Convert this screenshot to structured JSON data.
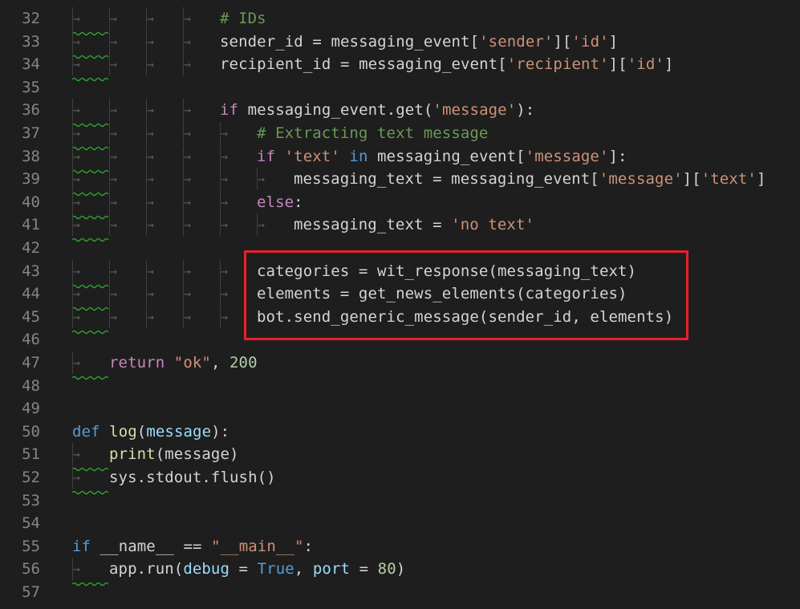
{
  "editor": {
    "lines": [
      {
        "n": "32",
        "indent": 4,
        "tokens": [
          {
            "t": "# IDs",
            "c": "cm"
          }
        ]
      },
      {
        "n": "33",
        "indent": 4,
        "tokens": [
          {
            "t": "sender_id",
            "c": "plain"
          },
          {
            "t": " = ",
            "c": "plain"
          },
          {
            "t": "messaging_event",
            "c": "plain"
          },
          {
            "t": "[",
            "c": "plain"
          },
          {
            "t": "'sender'",
            "c": "str"
          },
          {
            "t": "][",
            "c": "plain"
          },
          {
            "t": "'id'",
            "c": "str"
          },
          {
            "t": "]",
            "c": "plain"
          }
        ]
      },
      {
        "n": "34",
        "indent": 4,
        "tokens": [
          {
            "t": "recipient_id",
            "c": "plain"
          },
          {
            "t": " = ",
            "c": "plain"
          },
          {
            "t": "messaging_event",
            "c": "plain"
          },
          {
            "t": "[",
            "c": "plain"
          },
          {
            "t": "'recipient'",
            "c": "str"
          },
          {
            "t": "][",
            "c": "plain"
          },
          {
            "t": "'id'",
            "c": "str"
          },
          {
            "t": "]",
            "c": "plain"
          }
        ]
      },
      {
        "n": "35",
        "indent": 0,
        "tokens": []
      },
      {
        "n": "36",
        "indent": 4,
        "tokens": [
          {
            "t": "if",
            "c": "kw"
          },
          {
            "t": " messaging_event.get(",
            "c": "plain"
          },
          {
            "t": "'message'",
            "c": "str"
          },
          {
            "t": "):",
            "c": "plain"
          }
        ]
      },
      {
        "n": "37",
        "indent": 5,
        "tokens": [
          {
            "t": "# Extracting text message",
            "c": "cm"
          }
        ]
      },
      {
        "n": "38",
        "indent": 5,
        "tokens": [
          {
            "t": "if",
            "c": "kw"
          },
          {
            "t": " ",
            "c": "plain"
          },
          {
            "t": "'text'",
            "c": "str"
          },
          {
            "t": " ",
            "c": "plain"
          },
          {
            "t": "in",
            "c": "kw2"
          },
          {
            "t": " messaging_event[",
            "c": "plain"
          },
          {
            "t": "'message'",
            "c": "str"
          },
          {
            "t": "]:",
            "c": "plain"
          }
        ]
      },
      {
        "n": "39",
        "indent": 6,
        "tokens": [
          {
            "t": "messaging_text = messaging_event[",
            "c": "plain"
          },
          {
            "t": "'message'",
            "c": "str"
          },
          {
            "t": "][",
            "c": "plain"
          },
          {
            "t": "'text'",
            "c": "str"
          },
          {
            "t": "]",
            "c": "plain"
          }
        ]
      },
      {
        "n": "40",
        "indent": 5,
        "tokens": [
          {
            "t": "else",
            "c": "kw"
          },
          {
            "t": ":",
            "c": "plain"
          }
        ]
      },
      {
        "n": "41",
        "indent": 6,
        "tokens": [
          {
            "t": "messaging_text = ",
            "c": "plain"
          },
          {
            "t": "'no text'",
            "c": "str"
          }
        ]
      },
      {
        "n": "42",
        "indent": 0,
        "tokens": []
      },
      {
        "n": "43",
        "indent": 5,
        "tokens": [
          {
            "t": "categories = wit_response(messaging_text)",
            "c": "plain"
          }
        ]
      },
      {
        "n": "44",
        "indent": 5,
        "tokens": [
          {
            "t": "elements = get_news_elements(categories)",
            "c": "plain"
          }
        ]
      },
      {
        "n": "45",
        "indent": 5,
        "tokens": [
          {
            "t": "bot.send_generic_message(sender_id, elements)",
            "c": "plain"
          }
        ]
      },
      {
        "n": "46",
        "indent": 0,
        "tokens": []
      },
      {
        "n": "47",
        "indent": 1,
        "tokens": [
          {
            "t": "return",
            "c": "kw"
          },
          {
            "t": " ",
            "c": "plain"
          },
          {
            "t": "\"ok\"",
            "c": "str"
          },
          {
            "t": ", ",
            "c": "plain"
          },
          {
            "t": "200",
            "c": "num"
          }
        ]
      },
      {
        "n": "48",
        "indent": 0,
        "tokens": []
      },
      {
        "n": "49",
        "indent": 0,
        "tokens": []
      },
      {
        "n": "50",
        "indent": 0,
        "tokens": [
          {
            "t": "def",
            "c": "kw2"
          },
          {
            "t": " ",
            "c": "plain"
          },
          {
            "t": "log",
            "c": "fn"
          },
          {
            "t": "(",
            "c": "plain"
          },
          {
            "t": "message",
            "c": "var"
          },
          {
            "t": "):",
            "c": "plain"
          }
        ]
      },
      {
        "n": "51",
        "indent": 1,
        "tokens": [
          {
            "t": "print",
            "c": "fn"
          },
          {
            "t": "(message)",
            "c": "plain"
          }
        ]
      },
      {
        "n": "52",
        "indent": 1,
        "tokens": [
          {
            "t": "sys.stdout.flush()",
            "c": "plain"
          }
        ]
      },
      {
        "n": "53",
        "indent": 0,
        "tokens": []
      },
      {
        "n": "54",
        "indent": 0,
        "tokens": []
      },
      {
        "n": "55",
        "indent": 0,
        "tokens": [
          {
            "t": "if",
            "c": "kw2"
          },
          {
            "t": " __name__ == ",
            "c": "plain"
          },
          {
            "t": "\"__main__\"",
            "c": "str"
          },
          {
            "t": ":",
            "c": "plain"
          }
        ]
      },
      {
        "n": "56",
        "indent": 1,
        "tokens": [
          {
            "t": "app.run(",
            "c": "plain"
          },
          {
            "t": "debug",
            "c": "var"
          },
          {
            "t": " = ",
            "c": "plain"
          },
          {
            "t": "True",
            "c": "kw2"
          },
          {
            "t": ", ",
            "c": "plain"
          },
          {
            "t": "port",
            "c": "var"
          },
          {
            "t": " = ",
            "c": "plain"
          },
          {
            "t": "80",
            "c": "num"
          },
          {
            "t": ")",
            "c": "plain"
          }
        ]
      },
      {
        "n": "57",
        "indent": 0,
        "tokens": []
      }
    ],
    "colors": {
      "background": "#1e1e1e",
      "line_number": "#858585",
      "keyword": "#c586c0",
      "keyword_blue": "#569cd6",
      "string": "#ce9178",
      "number": "#b5cea8",
      "comment": "#6a9955",
      "highlight_box": "#e8202a",
      "squiggle": "#2e9e2e"
    }
  }
}
